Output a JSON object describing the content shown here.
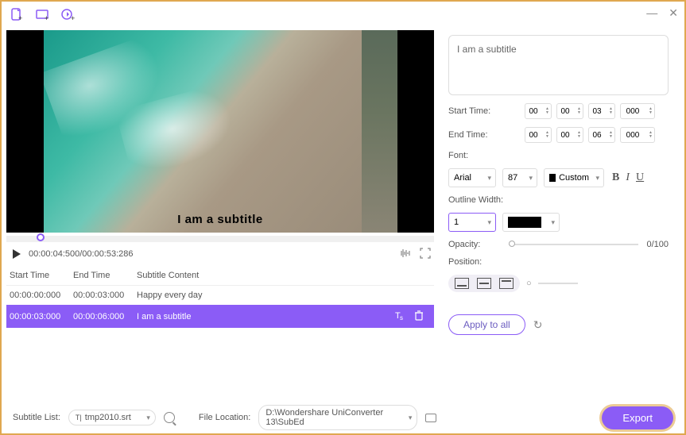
{
  "toolbar": {
    "win_minimize": "—",
    "win_close": "✕"
  },
  "video": {
    "subtitle_overlay": "I am a subtitle"
  },
  "playbar": {
    "timecode": "00:00:04:500/00:00:53:286"
  },
  "table": {
    "headers": {
      "start": "Start Time",
      "end": "End Time",
      "content": "Subtitle Content"
    },
    "rows": [
      {
        "start": "00:00:00:000",
        "end": "00:00:03:000",
        "content": "Happy every day",
        "active": false
      },
      {
        "start": "00:00:03:000",
        "end": "00:00:06:000",
        "content": "I am a subtitle",
        "active": true
      }
    ]
  },
  "editor": {
    "text": "I am a subtitle",
    "start_label": "Start Time:",
    "end_label": "End Time:",
    "start": {
      "h": "00",
      "m": "00",
      "s": "03",
      "ms": "000"
    },
    "end": {
      "h": "00",
      "m": "00",
      "s": "06",
      "ms": "000"
    },
    "font_label": "Font:",
    "font": "Arial",
    "size": "87",
    "color_label": "Custom",
    "outline_label": "Outline Width:",
    "outline_width": "1",
    "opacity_label": "Opacity:",
    "opacity_value": "0/100",
    "position_label": "Position:",
    "apply_label": "Apply to all"
  },
  "footer": {
    "subtitle_list_label": "Subtitle List:",
    "subtitle_file": "tmp2010.srt",
    "file_loc_label": "File Location:",
    "file_loc": "D:\\Wondershare UniConverter 13\\SubEd",
    "export_label": "Export"
  }
}
